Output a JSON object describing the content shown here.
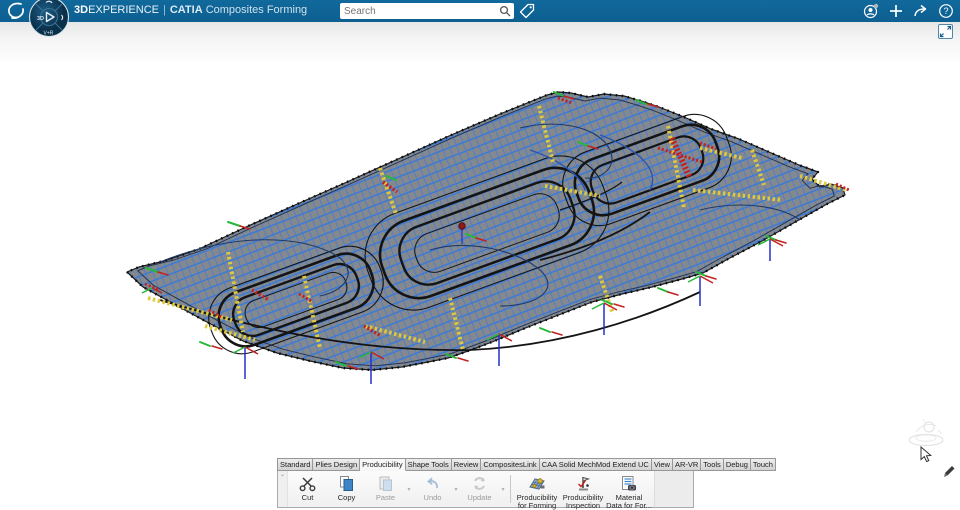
{
  "theme": {
    "header_bar": "#0d6191",
    "surface_gray": "#85898e",
    "mesh_blue": "#3a79d8",
    "warning_yellow": "#ddc93e",
    "critical_red": "#c42020",
    "ok_green": "#27b838",
    "axis_blue": "#2430c8",
    "contour_black": "#141414"
  },
  "header": {
    "brand": {
      "bold": "3D",
      "rest": "EXPERIENCE",
      "separator": "|",
      "app": "CATIA",
      "context": "Composites Forming"
    },
    "search": {
      "placeholder": "Search"
    },
    "icons": [
      "ds-logo",
      "compass",
      "tag-icon",
      "user-avatar-icon",
      "add-icon",
      "share-icon",
      "help-icon"
    ]
  },
  "compass": {
    "west": "3D",
    "south": "V+R"
  },
  "viewport": {
    "model": {
      "name": "composite-panel-forming-producibility-mesh",
      "legend": {
        "surface": "gray base surface",
        "mesh": "blue fiber mesh",
        "warning": "yellow high-deformation zones",
        "critical": "red critical zones",
        "contours": "black ply boundary contours",
        "axes": "blue/red/green constraint triads"
      }
    },
    "overlays": {
      "restore_icon": "resize-arrows-icon",
      "ghost": "robot-ghost-icon",
      "cursor": "arrow-cursor",
      "annotate": "pencil-icon"
    }
  },
  "action_bar": {
    "dropdown_glyph": "▾",
    "gutter_glyph": "⌄",
    "tabs": [
      {
        "label": "Standard",
        "active": false
      },
      {
        "label": "Plies Design",
        "active": false
      },
      {
        "label": "Producibility",
        "active": true
      },
      {
        "label": "Shape Tools",
        "active": false
      },
      {
        "label": "Review",
        "active": false
      },
      {
        "label": "CompositesLink",
        "active": false
      },
      {
        "label": "CAA Solid MechMod Extend UC",
        "active": false
      },
      {
        "label": "View",
        "active": false
      },
      {
        "label": "AR-VR",
        "active": false
      },
      {
        "label": "Tools",
        "active": false
      },
      {
        "label": "Debug",
        "active": false
      },
      {
        "label": "Touch",
        "active": false
      }
    ],
    "buttons": [
      {
        "id": "cut",
        "lines": [
          "Cut"
        ],
        "icon": "scissors-icon",
        "enabled": true,
        "dropdown": false,
        "big": false
      },
      {
        "id": "copy",
        "lines": [
          "Copy"
        ],
        "icon": "copy-icon",
        "enabled": true,
        "dropdown": false,
        "big": false
      },
      {
        "id": "paste",
        "lines": [
          "Paste"
        ],
        "icon": "paste-icon",
        "enabled": false,
        "dropdown": true,
        "big": false
      },
      {
        "id": "undo",
        "lines": [
          "Undo"
        ],
        "icon": "undo-icon",
        "enabled": false,
        "dropdown": true,
        "big": false
      },
      {
        "id": "update",
        "lines": [
          "Update"
        ],
        "icon": "update-icon",
        "enabled": false,
        "dropdown": true,
        "big": false
      },
      {
        "id": "separator-1",
        "separator": true
      },
      {
        "id": "producibility-for-forming",
        "lines": [
          "Producibility",
          "for Forming"
        ],
        "icon": "producibility-forming-icon",
        "enabled": true,
        "dropdown": false,
        "big": true
      },
      {
        "id": "producibility-inspection",
        "lines": [
          "Producibility",
          "Inspection"
        ],
        "icon": "producibility-inspection-icon",
        "enabled": true,
        "dropdown": false,
        "big": true
      },
      {
        "id": "material-data",
        "lines": [
          "Material",
          "Data for For..."
        ],
        "icon": "material-data-icon",
        "enabled": true,
        "dropdown": false,
        "big": true
      }
    ]
  }
}
